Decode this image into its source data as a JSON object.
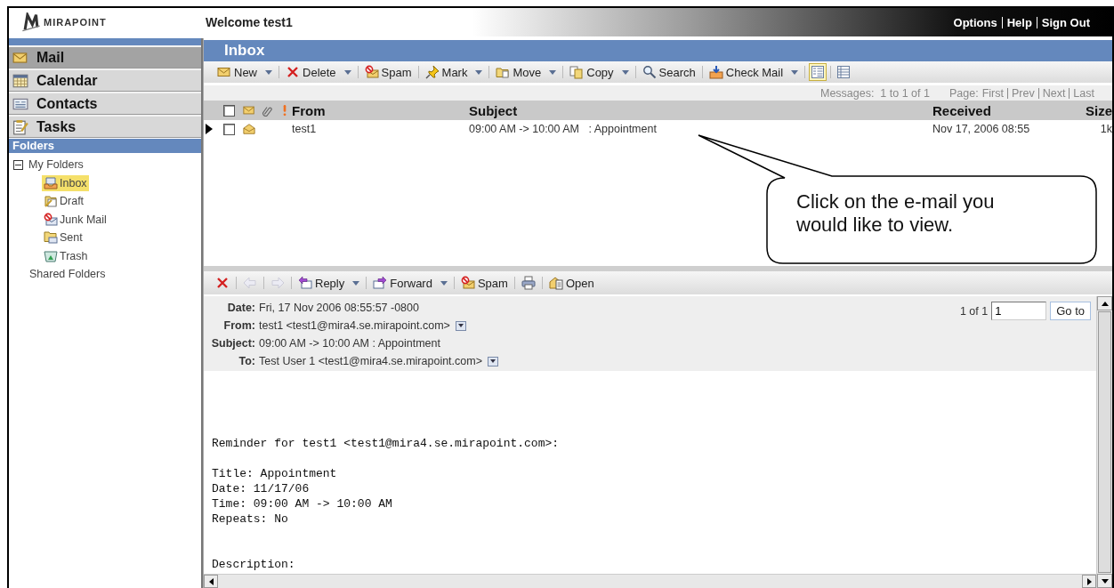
{
  "header": {
    "logo": "MIRAPOINT",
    "welcome": "Welcome test1",
    "links": [
      "Options",
      "Help",
      "Sign Out"
    ]
  },
  "nav": [
    {
      "label": "Mail",
      "kind": "mail",
      "selected": true
    },
    {
      "label": "Calendar",
      "kind": "calendar",
      "selected": false
    },
    {
      "label": "Contacts",
      "kind": "contacts",
      "selected": false
    },
    {
      "label": "Tasks",
      "kind": "tasks",
      "selected": false
    }
  ],
  "folders": {
    "title": "Folders",
    "my_folders": {
      "label": "My Folders",
      "expanded": true,
      "children": [
        {
          "label": "Inbox",
          "kind": "inbox",
          "selected": true
        },
        {
          "label": "Draft",
          "kind": "draft",
          "selected": false
        },
        {
          "label": "Junk Mail",
          "kind": "junk",
          "selected": false
        },
        {
          "label": "Sent",
          "kind": "sent",
          "selected": false
        },
        {
          "label": "Trash",
          "kind": "trash",
          "selected": false
        }
      ]
    },
    "shared_folders": {
      "label": "Shared Folders"
    }
  },
  "inbox": {
    "title": "Inbox",
    "toolbar": [
      {
        "label": "New",
        "kind": "new",
        "menu": true
      },
      {
        "label": "Delete",
        "kind": "delete",
        "menu": true
      },
      {
        "label": "Spam",
        "kind": "spam",
        "menu": false
      },
      {
        "label": "Mark",
        "kind": "mark",
        "menu": true
      },
      {
        "label": "Move",
        "kind": "move",
        "menu": true
      },
      {
        "label": "Copy",
        "kind": "copy",
        "menu": true
      },
      {
        "label": "Search",
        "kind": "search",
        "menu": false
      },
      {
        "label": "Check Mail",
        "kind": "checkmail",
        "menu": true
      }
    ],
    "views": [
      {
        "kind": "preview",
        "selected": true
      },
      {
        "kind": "list",
        "selected": false
      }
    ],
    "messages": "Messages:  1 to 1 of 1",
    "page_label": "Page:",
    "pager": [
      "First",
      "Prev",
      "Next",
      "Last"
    ],
    "all_checked": false,
    "columns": [
      "From",
      "Subject",
      "Received",
      "Size"
    ],
    "rows": [
      {
        "current": true,
        "checked": false,
        "from": "test1",
        "subject": "09:00 AM -> 10:00 AM   : Appointment",
        "received": "Nov 17, 2006 08:55",
        "size": "1k"
      }
    ]
  },
  "callout": "Click on the e-mail you would like to view.",
  "reader": {
    "toolbar": [
      {
        "kind": "delete",
        "menu": false,
        "disabled": false
      },
      {
        "kind": "previous",
        "menu": false,
        "disabled": true
      },
      {
        "kind": "next",
        "menu": false,
        "disabled": true
      },
      {
        "kind": "reply",
        "label": "Reply",
        "menu": true,
        "disabled": false
      },
      {
        "kind": "forward",
        "label": "Forward",
        "menu": true,
        "disabled": false
      },
      {
        "kind": "spam",
        "label": "Spam",
        "menu": false,
        "disabled": false
      },
      {
        "kind": "print",
        "menu": false,
        "disabled": false
      },
      {
        "kind": "open",
        "label": "Open",
        "menu": false,
        "disabled": false
      }
    ],
    "headers": [
      {
        "label": "Date:",
        "value": "Fri, 17 Nov 2006 08:55:57 -0800",
        "menu": false
      },
      {
        "label": "From:",
        "value": "test1 <test1@mira4.se.mirapoint.com>",
        "menu": true
      },
      {
        "label": "Subject:",
        "value": "09:00 AM -> 10:00 AM : Appointment",
        "menu": false
      },
      {
        "label": "To:",
        "value": "Test User 1 <test1@mira4.se.mirapoint.com>",
        "menu": true
      }
    ],
    "position": "1 of 1",
    "page_value": "1",
    "goto": "Go to",
    "body": [
      [
        "Reminder for test1 <test1@mira4.se.mirapoint.com>:"
      ],
      [
        "Title: Appointment",
        "Date: 11/17/06",
        "Time: 09:00 AM -> 10:00 AM",
        "Repeats: No"
      ],
      [
        "Description:"
      ]
    ]
  }
}
